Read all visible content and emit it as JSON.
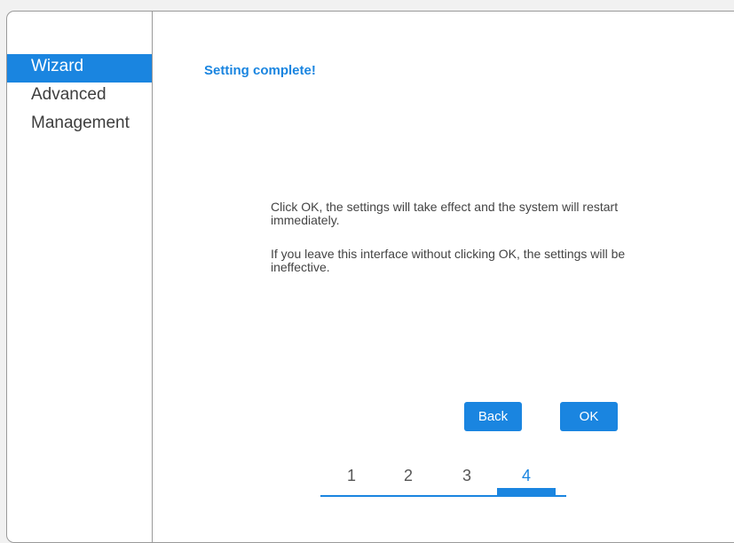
{
  "sidebar": {
    "items": [
      {
        "label": "Wizard",
        "active": true
      },
      {
        "label": "Advanced",
        "active": false
      },
      {
        "label": "Management",
        "active": false
      }
    ]
  },
  "main": {
    "title": "Setting complete!",
    "message1": "Click OK, the settings will take effect and the system will restart immediately.",
    "message2": "If you leave this interface without clicking OK, the settings will be ineffective.",
    "back_label": "Back",
    "ok_label": "OK"
  },
  "steps": {
    "labels": [
      "1",
      "2",
      "3",
      "4"
    ],
    "current": 4
  },
  "colors": {
    "accent": "#1a85e0",
    "text": "#444444",
    "border": "#9a9a9a"
  }
}
